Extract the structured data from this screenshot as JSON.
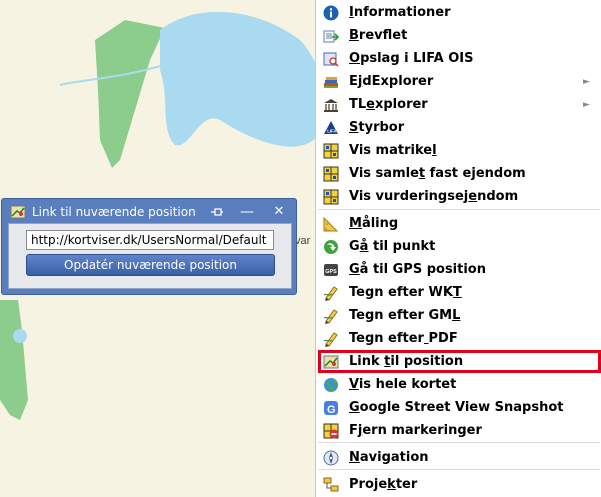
{
  "popup": {
    "title": "Link til nuværende position",
    "url_value": "http://kortviser.dk/UsersNormal/Default",
    "update_button": "Opdatér nuværende position",
    "pin_glyph": "⊣⊢",
    "minimize_glyph": "—",
    "close_glyph": "✕"
  },
  "map_fragment": "var",
  "menu": {
    "items": [
      {
        "label": "Informationer",
        "icon": "info-icon"
      },
      {
        "label": "Brevflet",
        "icon": "mail-merge-icon"
      },
      {
        "label": "Opslag i LIFA OIS",
        "icon": "lookup-icon"
      },
      {
        "label": "EjdExplorer",
        "icon": "books-icon",
        "submenu": true
      },
      {
        "label": "TLexplorer",
        "icon": "building-icon",
        "submenu": true
      },
      {
        "label": "Styrbor",
        "icon": "lifa-icon"
      },
      {
        "label": "Vis matrikel",
        "icon": "cadastre-icon"
      },
      {
        "label": "Vis samlet fast ejendom",
        "icon": "cadastre-icon"
      },
      {
        "label": "Vis vurderingsejendom",
        "icon": "cadastre-icon"
      },
      {
        "label": "Måling",
        "icon": "ruler-icon"
      },
      {
        "label": "Gå til punkt",
        "icon": "goto-arrow-icon"
      },
      {
        "label": "Gå til GPS position",
        "icon": "gps-icon"
      },
      {
        "label": "Tegn efter WKT",
        "icon": "pencil-icon"
      },
      {
        "label": "Tegn efter GML",
        "icon": "pencil-icon"
      },
      {
        "label": "Tegn efter PDF",
        "icon": "pencil-icon"
      },
      {
        "label": "Link til position",
        "icon": "link-map-icon",
        "highlighted": true
      },
      {
        "label": "Vis hele kortet",
        "icon": "globe-icon"
      },
      {
        "label": "Google Street View Snapshot",
        "icon": "google-icon"
      },
      {
        "label": "Fjern markeringer",
        "icon": "remove-markers-icon"
      },
      {
        "label": "Navigation",
        "icon": "compass-icon"
      },
      {
        "label": "Projekter",
        "icon": "projects-icon"
      }
    ],
    "submenu_arrow": "►"
  },
  "colors": {
    "highlight_border": "#e0001b",
    "popup_blue": "#5b7fbe",
    "water": "#aadaf0",
    "forest": "#8ccc8c",
    "land": "#f7f3e2"
  }
}
